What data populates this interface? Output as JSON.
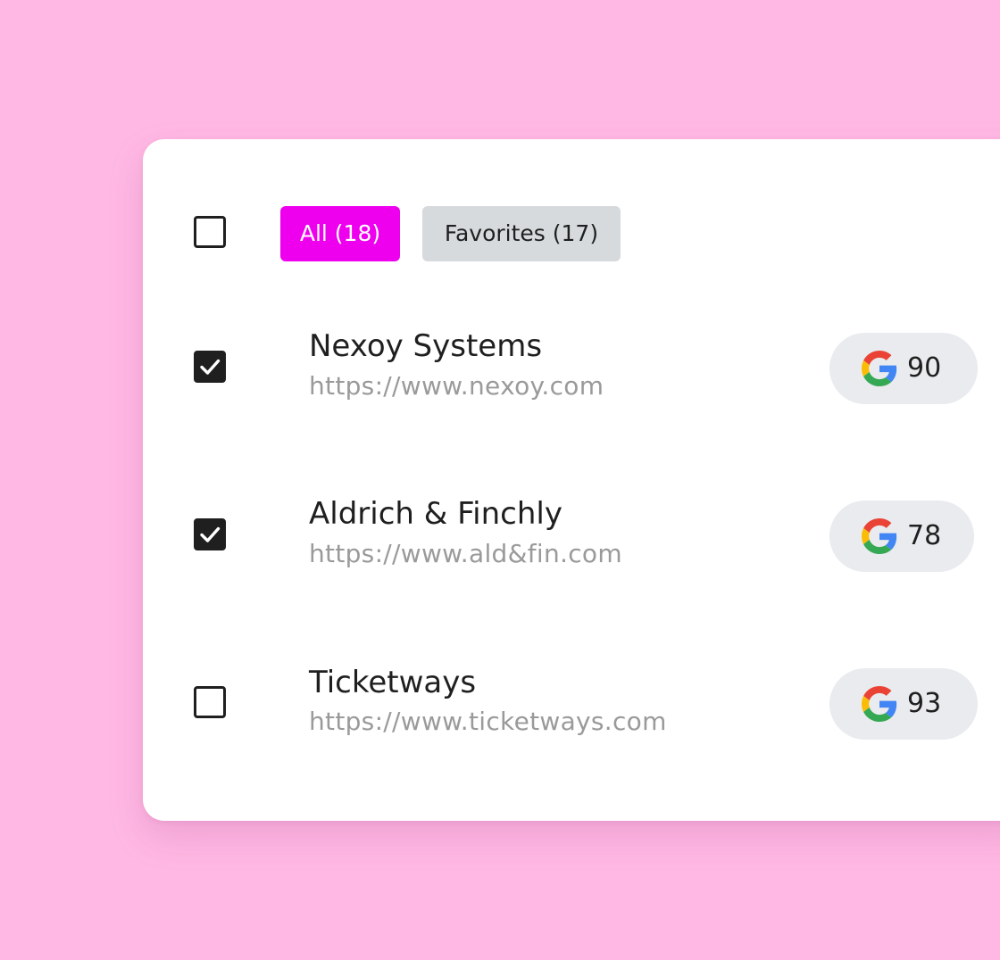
{
  "colors": {
    "background": "#ffb8e4",
    "accent": "#ee00ee",
    "chip_inactive": "#d6dadd"
  },
  "header": {
    "select_all_checked": false,
    "tabs": [
      {
        "label": "All (18)",
        "active": true
      },
      {
        "label": "Favorites (17)",
        "active": false
      }
    ]
  },
  "rows": [
    {
      "name": "Nexoy Systems",
      "url": "https://www.nexoy.com",
      "checked": true,
      "score_icon": "google-icon",
      "score": "90"
    },
    {
      "name": "Aldrich & Finchly",
      "url": "https://www.ald&fin.com",
      "checked": true,
      "score_icon": "google-icon",
      "score": "78"
    },
    {
      "name": "Ticketways",
      "url": "https://www.ticketways.com",
      "checked": false,
      "score_icon": "google-icon",
      "score": "93"
    }
  ]
}
